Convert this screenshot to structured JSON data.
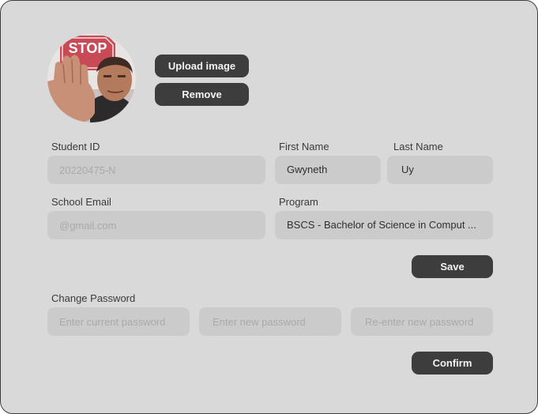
{
  "profile": {
    "upload_label": "Upload image",
    "remove_label": "Remove",
    "avatar_sign_text": "STOP"
  },
  "form": {
    "student_id": {
      "label": "Student ID",
      "placeholder": "20220475-N",
      "value": ""
    },
    "first_name": {
      "label": "First Name",
      "value": "Gwyneth"
    },
    "last_name": {
      "label": "Last Name",
      "value": "Uy"
    },
    "school_email": {
      "label": "School Email",
      "placeholder": "@gmail.com",
      "value": ""
    },
    "program": {
      "label": "Program",
      "value": "BSCS - Bachelor of Science in Comput ..."
    },
    "save_label": "Save"
  },
  "password": {
    "label": "Change Password",
    "current_placeholder": "Enter current password",
    "new_placeholder": "Enter new password",
    "reenter_placeholder": "Re-enter new password",
    "confirm_label": "Confirm"
  },
  "colors": {
    "card_background": "#d9d9d9",
    "field_background": "#cbcbcb",
    "button_background": "#3d3d3d",
    "button_text": "#f2f2f2"
  }
}
